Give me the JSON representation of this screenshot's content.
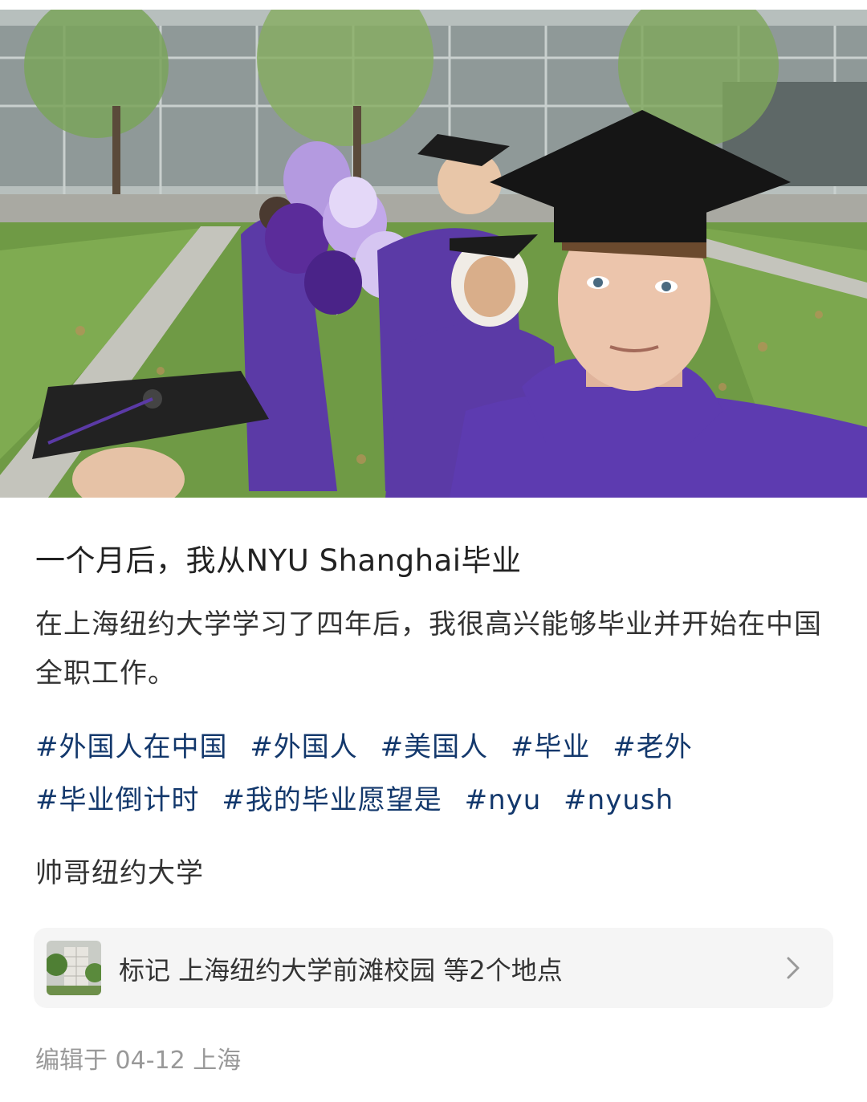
{
  "post": {
    "photo_icon": "graduation-selfie-photo",
    "title": "一个月后，我从NYU Shanghai毕业",
    "body": "在上海纽约大学学习了四年后，我很高兴能够毕业并开始在中国全职工作。",
    "tags": [
      "#外国人在中国",
      "#外国人",
      "#美国人",
      "#毕业",
      "#老外",
      "#毕业倒计时",
      "#我的毕业愿望是",
      "#nyu",
      "#nyush"
    ],
    "author_note": "帅哥纽约大学",
    "location": {
      "label": "标记 上海纽约大学前滩校园 等2个地点",
      "thumbnail_icon": "campus-thumbnail",
      "arrow_icon": "chevron-right-icon"
    },
    "meta": "编辑于 04-12 上海"
  },
  "colors": {
    "tag": "#13386c",
    "gown": "#5b3aa6",
    "card_bg": "#f5f5f5",
    "meta": "#999999"
  }
}
